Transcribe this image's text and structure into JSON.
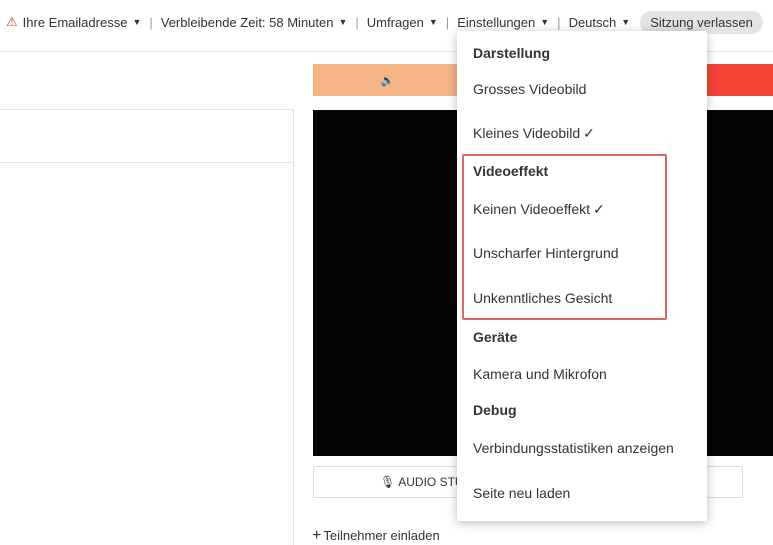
{
  "topbar": {
    "email_label": "Ihre Emailadresse",
    "time_label": "Verbleibende Zeit: 58 Minuten",
    "polls_label": "Umfragen",
    "settings_label": "Einstellungen",
    "language_label": "Deutsch",
    "separator": "|",
    "leave_label": "Sitzung verlassen"
  },
  "main": {
    "audio_button_label": "AUDIO STU",
    "invite_label": "Teilnehmer einladen"
  },
  "menu": {
    "display_header": "Darstellung",
    "large_video": "Grosses Videobild",
    "small_video": "Kleines Videobild",
    "effect_header": "Videoeffekt",
    "no_effect": "Keinen Videoeffekt",
    "blur_background": "Unscharfer Hintergrund",
    "unrecognizable_face": "Unkenntliches Gesicht",
    "devices_header": "Geräte",
    "camera_mic": "Kamera und Mikrofon",
    "debug_header": "Debug",
    "connection_stats": "Verbindungsstatistiken anzeigen",
    "reload_page": "Seite neu laden"
  },
  "icons": {
    "warning": "warning-icon",
    "caret": "caret-down-icon",
    "speaker": "speaker-icon",
    "microphone": "microphone-icon",
    "plus": "plus-icon",
    "check": "checkmark-icon"
  },
  "colors": {
    "audio_bar": "#f4b484",
    "red_bar": "#f44336",
    "warning": "#e53935",
    "highlight_border": "#e06666"
  }
}
